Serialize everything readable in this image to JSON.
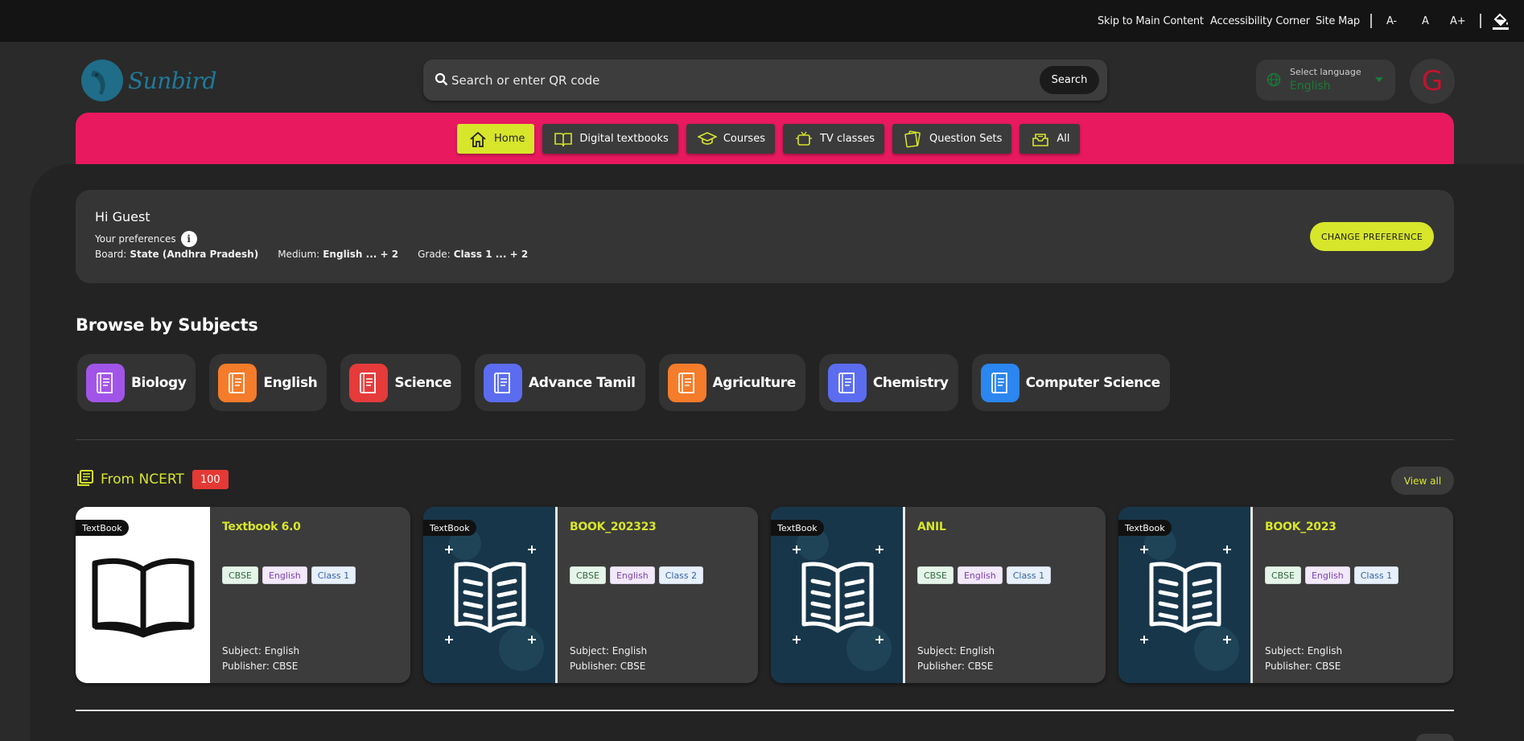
{
  "topbar": {
    "skip": "Skip to Main Content",
    "accessibility": "Accessibility Corner",
    "sitemap": "Site Map",
    "font_decrease": "A-",
    "font_normal": "A",
    "font_increase": "A+"
  },
  "header": {
    "logo_text": "Sunbird",
    "search_placeholder": "Search or enter QR code",
    "search_button": "Search",
    "language_label": "Select language",
    "language_value": "English",
    "avatar_initial": "G"
  },
  "nav": {
    "tabs": [
      {
        "label": "Home",
        "icon": "home-icon"
      },
      {
        "label": "Digital textbooks",
        "icon": "book-open-icon"
      },
      {
        "label": "Courses",
        "icon": "graduation-cap-icon"
      },
      {
        "label": "TV classes",
        "icon": "tv-icon"
      },
      {
        "label": "Question Sets",
        "icon": "question-set-icon"
      },
      {
        "label": "All",
        "icon": "inbox-icon"
      }
    ]
  },
  "preferences": {
    "greeting": "Hi Guest",
    "label": "Your preferences",
    "board_key": "Board:",
    "board_value": "State (Andhra Pradesh)",
    "medium_key": "Medium:",
    "medium_value": "English ... + 2",
    "grade_key": "Grade:",
    "grade_value": "Class 1 ... + 2",
    "change_button": "CHANGE PREFERENCE"
  },
  "browse": {
    "title": "Browse by Subjects",
    "subjects": [
      {
        "label": "Biology",
        "color": "#a155e8"
      },
      {
        "label": "English",
        "color": "#f57c2a"
      },
      {
        "label": "Science",
        "color": "#e53b3b"
      },
      {
        "label": "Advance Tamil",
        "color": "#5b6cf0"
      },
      {
        "label": "Agriculture",
        "color": "#f57c2a"
      },
      {
        "label": "Chemistry",
        "color": "#5b6cf0"
      },
      {
        "label": "Computer Science",
        "color": "#2b86f0"
      }
    ]
  },
  "ncert": {
    "title": "From NCERT",
    "count": "100",
    "view_all": "View all",
    "cards": [
      {
        "tag": "TextBook",
        "title": "Textbook 6.0",
        "board": "CBSE",
        "medium": "English",
        "grade": "Class 1",
        "subject": "Subject: English",
        "publisher": "Publisher: CBSE",
        "thumb": "white"
      },
      {
        "tag": "TextBook",
        "title": "BOOK_202323",
        "board": "CBSE",
        "medium": "English",
        "grade": "Class 2",
        "subject": "Subject: English",
        "publisher": "Publisher: CBSE",
        "thumb": "dark"
      },
      {
        "tag": "TextBook",
        "title": "ANIL",
        "board": "CBSE",
        "medium": "English",
        "grade": "Class 1",
        "subject": "Subject: English",
        "publisher": "Publisher: CBSE",
        "thumb": "dark"
      },
      {
        "tag": "TextBook",
        "title": "BOOK_2023",
        "board": "CBSE",
        "medium": "English",
        "grade": "Class 1",
        "subject": "Subject: English",
        "publisher": "Publisher: CBSE",
        "thumb": "dark"
      }
    ]
  },
  "colors": {
    "accent": "#d7e52b",
    "nav_band": "#e8195f",
    "language_green": "#1c7a3a"
  }
}
